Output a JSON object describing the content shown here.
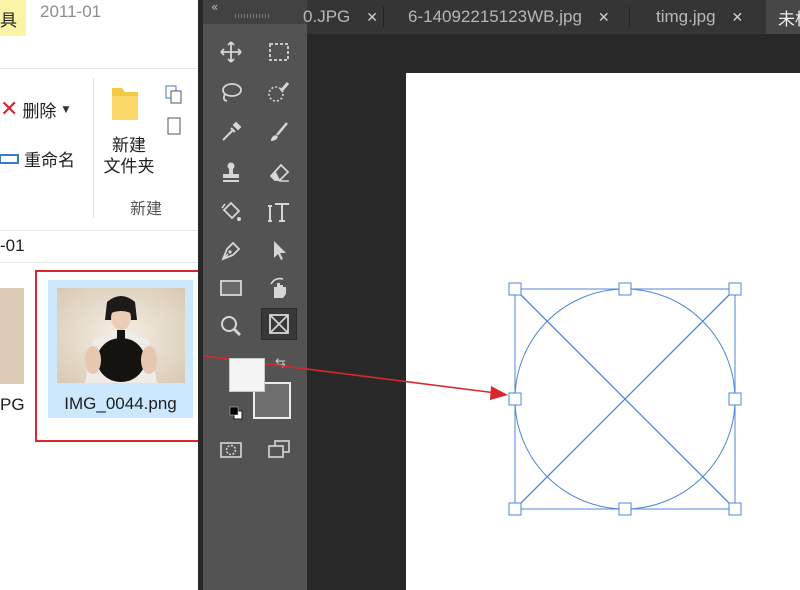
{
  "explorer": {
    "tab_partial": "具",
    "date_tab": "2011-01",
    "delete_label": "删除",
    "rename_label": "重命名",
    "new_folder_label": "新建\n文件夹",
    "new_folder_line1": "新建",
    "new_folder_line2": "文件夹",
    "group_new": "新建",
    "path_partial": "-01",
    "left_file_partial": "PG",
    "file_name": "IMG_0044.png"
  },
  "photoshop": {
    "tabs": [
      {
        "label": "0.JPG",
        "close": "✕"
      },
      {
        "label": "6-14092215123WB.jpg",
        "close": "✕"
      },
      {
        "label": "timg.jpg",
        "close": "✕"
      },
      {
        "label": "未标",
        "close": ""
      }
    ],
    "tools": [
      "move-icon",
      "marquee-icon",
      "lasso-icon",
      "quick-select-icon",
      "crop-icon",
      "brush-icon",
      "stamp-icon",
      "eraser-icon",
      "gradient-icon",
      "text-icon",
      "pen-icon",
      "path-select-icon",
      "rectangle-icon",
      "hand-rotate-icon",
      "zoom-icon",
      "frame-icon",
      "quickmask-icon",
      "screen-mode-icon"
    ],
    "colors": {
      "foreground": "#f4f4f4",
      "background": "#6e6e6e",
      "accent": "#4f86d9",
      "annotation": "#d9272e"
    }
  }
}
